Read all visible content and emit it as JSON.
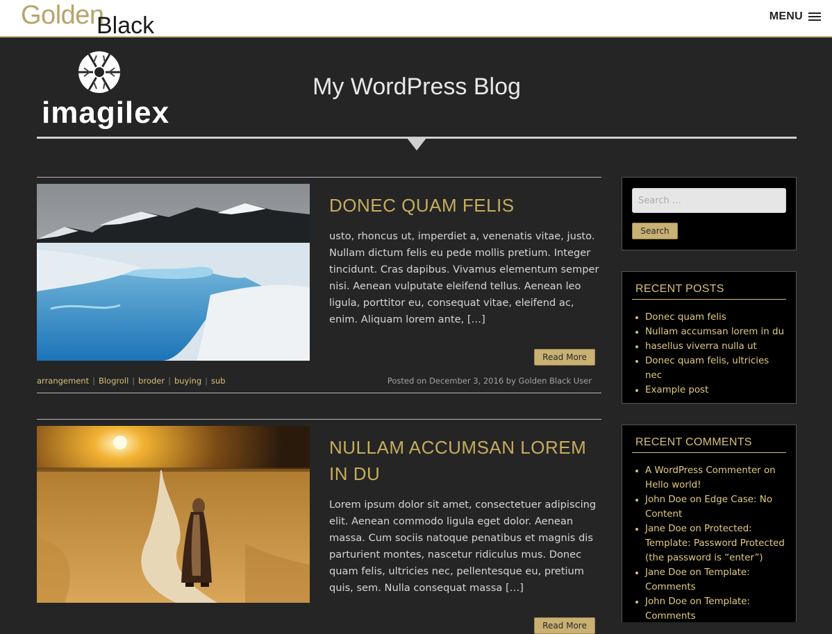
{
  "header": {
    "brand_gold": "Golden",
    "brand_black": "Black",
    "menu_label": "MENU",
    "logo_word": "imagilex",
    "site_title": "My WordPress Blog"
  },
  "posts": [
    {
      "title": "DONEC QUAM FELIS",
      "excerpt": "usto, rhoncus ut, imperdiet a, venenatis vitae, justo. Nullam dictum felis eu pede mollis pretium. Integer tincidunt. Cras dapibus. Vivamus elementum semper nisi. Aenean vulputate eleifend tellus. Aenean leo ligula, porttitor eu, consequat vitae, eleifend ac, enim. Aliquam lorem ante,",
      "more": "[…]",
      "read_more": "Read More",
      "tags": [
        "arrangement",
        "Blogroll",
        "broder",
        "buying",
        "sub"
      ],
      "posted": "Posted on December 3, 2016 by Golden Black User"
    },
    {
      "title": "NULLAM ACCUMSAN LOREM IN DU",
      "excerpt": "Lorem ipsum dolor sit amet, consectetuer adipiscing elit. Aenean commodo ligula eget dolor. Aenean massa. Cum sociis natoque penatibus et magnis dis parturient montes, nascetur ridiculus mus. Donec quam felis, ultricies nec, pellentesque eu, pretium quis, sem. Nulla consequat massa",
      "more": "[…]",
      "read_more": "Read More"
    }
  ],
  "sidebar": {
    "search_placeholder": "Search …",
    "search_button": "Search",
    "recent_posts_title": "RECENT POSTS",
    "recent_posts": [
      "Donec quam felis",
      "Nullam accumsan lorem in du",
      "hasellus viverra nulla ut",
      "Donec quam felis, ultricies nec",
      "Example post"
    ],
    "recent_comments_title": "RECENT COMMENTS",
    "recent_comments": [
      "A WordPress Commenter on Hello world!",
      "John Doe on Edge Case: No Content",
      "Jane Doe on Protected: Template: Password Protected (the password is “enter”)",
      "Jane Doe on Template: Comments",
      "John Doe on Template: Comments"
    ]
  },
  "colors": {
    "accent_gold": "#c7ad5e",
    "page_background": "#252525",
    "widget_background": "#000000"
  }
}
